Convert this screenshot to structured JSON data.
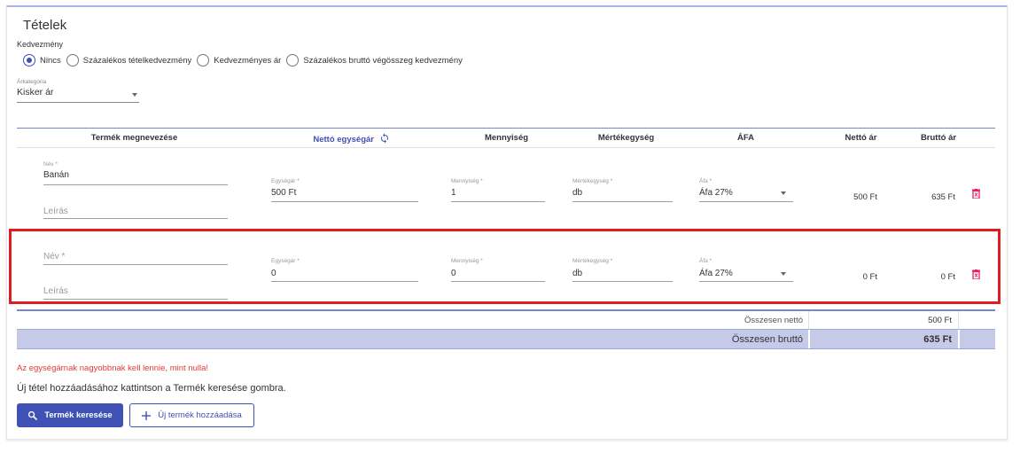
{
  "section_title": "Tételek",
  "discount": {
    "label": "Kedvezmény",
    "options": [
      "Nincs",
      "Százalékos tételkedvezmény",
      "Kedvezményes ár",
      "Százalékos bruttó végösszeg kedvezmény"
    ],
    "selected": "Nincs"
  },
  "price_category": {
    "label": "Árkategória",
    "value": "Kisker ár"
  },
  "table": {
    "headers": {
      "product_name": "Termék megnevezése",
      "net_unit_price": "Nettó egységár",
      "quantity": "Mennyiség",
      "unit": "Mértékegység",
      "vat": "ÁFA",
      "net_price": "Nettó ár",
      "gross_price": "Bruttó ár"
    },
    "labels": {
      "name": "Név *",
      "description": "Leírás",
      "unit_price": "Egységár *",
      "quantity": "Mennyiség *",
      "unit": "Mértékegység *",
      "vat": "Áfa *"
    },
    "rows": [
      {
        "name": "Banán",
        "unit_price": "500 Ft",
        "quantity": "1",
        "unit": "db",
        "vat": "Áfa 27%",
        "net_price": "500 Ft",
        "gross_price": "635 Ft"
      },
      {
        "name": "",
        "unit_price": "0",
        "quantity": "0",
        "unit": "db",
        "vat": "Áfa 27%",
        "net_price": "0 Ft",
        "gross_price": "0 Ft"
      }
    ]
  },
  "totals": {
    "net_label": "Összesen nettó",
    "net_value": "500 Ft",
    "gross_label": "Összesen bruttó",
    "gross_value": "635 Ft"
  },
  "error_message": "Az egységárnak nagyobbnak kell lennie, mint nulla!",
  "hint": "Új tétel hozzáadásához kattintson a Termék keresése gombra.",
  "buttons": {
    "search": "Termék keresése",
    "add_new": "Új termék hozzáadása"
  },
  "colors": {
    "primary": "#3f51b5",
    "error": "#e53935",
    "highlight_border": "#e11b22",
    "delete_icon": "#e91e63",
    "total_bar": "#c5cae9"
  }
}
